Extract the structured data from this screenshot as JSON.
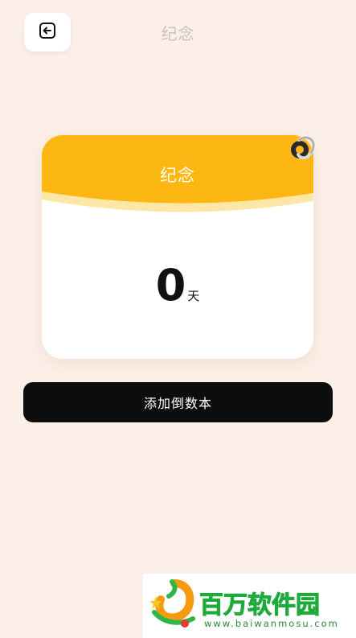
{
  "header": {
    "title": "纪念",
    "back_icon": "arrow-left-box-icon"
  },
  "card": {
    "title": "纪念",
    "count": "0",
    "unit": "天",
    "ring_icon": "binder-ring-icon",
    "colors": {
      "top": "#fdb712",
      "wave_light": "#fde7a6",
      "body": "#ffffff"
    }
  },
  "actions": {
    "add_label": "添加倒数本"
  },
  "watermark": {
    "name": "百万软件园",
    "url": "www.baiwanmosu.com"
  },
  "colors": {
    "background": "#fcefe7",
    "button": "#0d0d0d",
    "brand_green": "#1faa3c"
  }
}
